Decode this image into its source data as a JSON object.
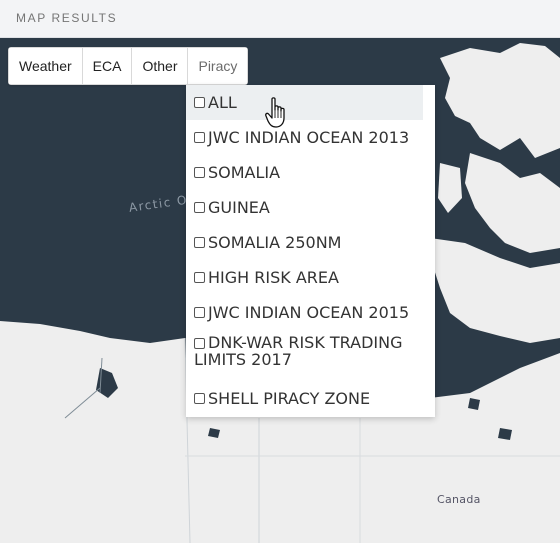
{
  "header": {
    "title": "MAP RESULTS"
  },
  "tabs": [
    {
      "label": "Weather"
    },
    {
      "label": "ECA"
    },
    {
      "label": "Other"
    },
    {
      "label": "Piracy"
    }
  ],
  "dropdown": {
    "items": [
      {
        "label": "ALL",
        "checked": false
      },
      {
        "label": "JWC INDIAN OCEAN 2013",
        "checked": false
      },
      {
        "label": "SOMALIA",
        "checked": false
      },
      {
        "label": "GUINEA",
        "checked": false
      },
      {
        "label": "SOMALIA 250NM",
        "checked": false
      },
      {
        "label": "HIGH RISK AREA",
        "checked": false
      },
      {
        "label": "JWC INDIAN OCEAN 2015",
        "checked": false
      },
      {
        "label": "DNK-WAR RISK TRADING LIMITS 2017",
        "checked": false
      },
      {
        "label": "SHELL PIRACY ZONE",
        "checked": false
      }
    ]
  },
  "map": {
    "ocean_label": "Arctic Oc",
    "country_label": "Canada",
    "land_color": "#eeeeee",
    "water_color": "#2c3a47"
  },
  "icons": {
    "cursor": "hand-pointer-icon"
  }
}
